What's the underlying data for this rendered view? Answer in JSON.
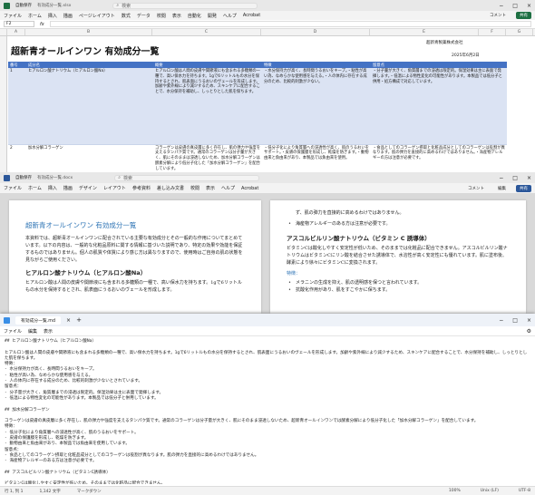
{
  "excel": {
    "title": "有効成分一覧.xlsx",
    "autosave": "自動保存",
    "search_placeholder": "検索",
    "menu": [
      "ファイル",
      "ホーム",
      "挿入",
      "描画",
      "ページレイアウト",
      "数式",
      "データ",
      "校閲",
      "表示",
      "自動化",
      "開発",
      "ヘルプ",
      "Acrobat"
    ],
    "comment_button": "コメント",
    "share_button": "共有",
    "name_box": "F2",
    "columns": [
      "A",
      "B",
      "C",
      "D",
      "E",
      "F",
      "G"
    ],
    "sheet_title": "超新青オールインワン 有効成分一覧",
    "company": "超新青製薬株式会社",
    "date": "2025年6月2日",
    "headers": [
      "番号",
      "成分名",
      "概要",
      "特徴",
      "留意点"
    ],
    "rows": [
      {
        "num": "1",
        "name": "ヒアルロン酸ナトリウム（ヒアルロン酸Na）",
        "summary": "ヒアルロン酸は人間の皮膚や関節液にも含まれる多糖類の一種で、高い保水力を持ちます。1gで6リットルもの水分を保持するとされ、肌表面にうるおいのヴェールを形成します。加齢や紫外線により減少するため、スキンケアに配合することで、水分保持を補助し、しっとりとした肌を保ちます。",
        "feature": "・水分保持力が高く、長時間うるおいをキープ。・粘性が高い為、なめらかな使用感を与える。・人の体内に存在する成分のため、比較的刺激が少ない。",
        "note": "・分子量が大きく、角質層までの浸透は限定的。保湿効果は主に表面で発揮します。・低温による物性変化の可能性があります。本製品では低分子と併用・処方構成で対応しています。"
      },
      {
        "num": "2",
        "name": "加水分解コラーゲン",
        "summary": "コラーゲンは皮膚の真皮層に多く存在し、肌の弾力や強度を支えるタンパク質です。通常のコラーゲンは分子量が大きく、肌にそのままは浸透しないため、加水分解コラーゲンは酵素分解により低分子化した「加水分解コラーゲン」を配合しています。",
        "feature": "・低分子化により角質層への浸透性が高く、肌のうるおいをサポート。・皮膚の保護膜を形成し、乾燥を防ぎます。・動物由来と魚由来があり、本製品では魚由来を使用。",
        "note": "・食品としてのコラーゲン摂取と化粧品成分としてのコラーゲンは役割が異なります。肌の弾力を直接的に高めるわけではありません。・海産物アレルギーの方は注意が必要です。"
      }
    ]
  },
  "word": {
    "title": "有効成分一覧.docx",
    "autosave": "自動保存",
    "search_placeholder": "検索",
    "menu": [
      "ファイル",
      "ホーム",
      "挿入",
      "描画",
      "デザイン",
      "レイアウト",
      "参考資料",
      "差し込み文書",
      "校閲",
      "表示",
      "ヘルプ",
      "Acrobat"
    ],
    "comment_button": "コメント",
    "edit_button": "編集",
    "share_button": "共有",
    "left": {
      "heading": "超新青オールインワン 有効成分一覧",
      "intro": "本資料では、超新青オールインワンに配合されている主要な有効成分とその一般的な作用についてまとめています。以下の内容は、一般的な化粧品原料に関する情報に基づいた説明であり、特定の効果や効能を保証するものではありません。個人の肌質や体質により感じ方は異なりますので、使用時はご自身の肌の状態を見ながらご使用ください。",
      "h2": "ヒアルロン酸ナトリウム（ヒアルロン酸Na）",
      "p2": "ヒアルロン酸は人間の皮膚や関節液にも含まれる多糖類の一種で、高い保水力を持ちます。1gで6リットルもの水分を保持するとされ、肌表面にうるおいのヴェールを形成します。"
    },
    "right": {
      "cont": "ず、肌の弾力を直接的に高めるわけではありません。",
      "bullet": "海産物アレルギーのある方は注意が必要です。",
      "h2": "アスコルビルリン酸ナトリウム（ビタミン C 誘導体）",
      "p": "ビタミンCは酸化しやすく安定性が低いため、そのままでは化粧品に配合できません。アスコルビルリン酸ナトリウムはビタミンCにリン酸を結合させた誘導体で、水溶性が高く安定性にも優れています。肌に塗布後、酵素により徐々にビタミンCに変換されます。",
      "label": "特徴：",
      "items": [
        "メラニンの生成を抑え、肌の透明感を保つと言われています。",
        "抗酸化作用があり、肌をすこやかに保ちます。"
      ]
    }
  },
  "notepad": {
    "title": "有効成分一覧.md",
    "menu": [
      "ファイル",
      "編集",
      "表示"
    ],
    "text": "## ヒアルロン酸ナトリウム（ヒアルロン酸Na）\n\nヒアルロン酸は人間の皮膚や関節液にも含まれる多糖類の一種で、高い保水力を持ちます。1gで6リットルもの水分を保持するとされ、肌表面にうるおいのヴェールを形成します。加齢や紫外線により減少するため、スキンケアに配合することで、水分保持を補助し、しっとりとした肌を保ちます。\n特徴：\n- 水分保持力が高く、長時間うるおいをキープ。\n- 粘性が高い為、なめらかな使用感を与える。\n- 人の体内に存在する成分のため、比較的刺激が少ないとされています。\n留意点：\n- 分子量が大きく、角質層までの浸透は限定的。保湿効果は主に表面で発揮します。\n- 低温による物性変化の可能性があります。本製品では低分子と併用しています。\n\n## 加水分解コラーゲン\n\nコラーゲンは皮膚の真皮層に多く存在し、肌の弾力や強度を支えるタンパク質です。通常のコラーゲンは分子量が大きく、肌にそのまま浸透しないため、超新青オールインワンでは酵素分解により低分子化した「加水分解コラーゲン」を配合しています。\n特徴：\n- 低分子化により角質層への浸透性が高く、肌のうるおいをサポート。\n- 皮膚の保護膜を形成し、乾燥を防ぎます。\n- 動物由来と魚由来があり、本製品では魚由来を使用しています。\n留意点：\n- 食品としてのコラーゲン摂取と化粧品成分としてのコラーゲンは役割が異なります。肌の弾力を直接的に高めるわけではありません。\n- 海産物アレルギーのある方は注意が必要です。\n\n## アスコルビルリン酸ナトリウム（ビタミンC誘導体）\n\nビタミンCは酸化しやすく安定性が低いため、そのままでは化粧品に配合できません。\nアスコルビルリン酸ナトリウムはビタミンCにリン酸を結合させた誘導体で、水溶性が高く安定性にも優れています。肌に塗布後、酵素により徐々にビタミンCに変換されます。",
    "status": {
      "pos": "行 1, 列 1",
      "chars": "1,142 文字",
      "lang": "マークダウン",
      "zoom": "100%",
      "eol": "Unix (LF)",
      "enc": "UTF-8"
    }
  }
}
